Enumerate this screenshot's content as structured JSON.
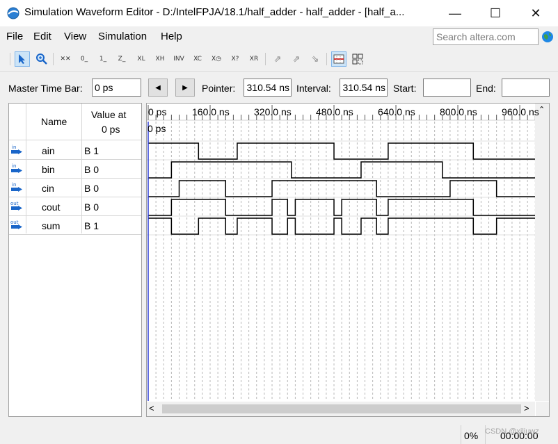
{
  "window": {
    "title": "Simulation Waveform Editor - D:/IntelFPJA/18.1/half_adder - half_adder - [half_a...",
    "minimize": "—",
    "maximize": "☐",
    "close": "✕"
  },
  "menu": {
    "file": "File",
    "edit": "Edit",
    "view": "View",
    "simulation": "Simulation",
    "help": "Help",
    "search_placeholder": "Search altera.com"
  },
  "toolbar": {
    "icons": [
      "pointer-icon",
      "zoom-icon",
      "unknown-value-icon",
      "forcing-low-icon",
      "forcing-high-icon",
      "high-impedance-icon",
      "weak-low-icon",
      "weak-high-icon",
      "invert-icon",
      "count-value-icon",
      "clock-icon",
      "arbitrary-value-icon",
      "random-value-icon",
      "run-functional-icon",
      "run-timing-icon",
      "timing-netlist-icon",
      "snap-to-grid-icon",
      "grid-settings-icon"
    ],
    "glyphs": [
      "⬉",
      "🔍",
      "X̲",
      "0̲",
      "1̲",
      "Z̲",
      "X̲L",
      "X̲H",
      "INV",
      "X̲C",
      "X̲○",
      "X̲?",
      "X̲R",
      "⇗",
      "⇗",
      "⇘",
      "▦",
      "▩"
    ]
  },
  "timebar": {
    "master_label": "Master Time Bar:",
    "master_value": "0 ps",
    "prev_glyph": "◀",
    "next_glyph": "▶",
    "pointer_label": "Pointer:",
    "pointer_value": "310.54 ns",
    "interval_label": "Interval:",
    "interval_value": "310.54 ns",
    "start_label": "Start:",
    "start_value": "",
    "end_label": "End:",
    "end_value": ""
  },
  "signals_header": {
    "name": "Name",
    "value_line1": "Value at",
    "value_line2": "0 ps"
  },
  "signals": [
    {
      "dir": "in",
      "name": "ain",
      "value": "B 1"
    },
    {
      "dir": "in",
      "name": "bin",
      "value": "B 0"
    },
    {
      "dir": "in",
      "name": "cin",
      "value": "B 0"
    },
    {
      "dir": "out",
      "name": "cout",
      "value": "B 0"
    },
    {
      "dir": "out",
      "name": "sum",
      "value": "B 1"
    }
  ],
  "timeline": {
    "ticks": [
      "0 ps",
      "160.0 ns",
      "320.0 ns",
      "480.0 ns",
      "640.0 ns",
      "800.0 ns",
      "960.0 ns"
    ],
    "cursor_label": "0 ps",
    "unit_ns_per_tick": 160
  },
  "waveforms": {
    "ain": [
      [
        0,
        1
      ],
      [
        130,
        0
      ],
      [
        230,
        1
      ],
      [
        480,
        0
      ],
      [
        620,
        1
      ],
      [
        840,
        0
      ],
      [
        1000,
        0
      ]
    ],
    "bin": [
      [
        0,
        0
      ],
      [
        60,
        1
      ],
      [
        370,
        0
      ],
      [
        550,
        1
      ],
      [
        760,
        0
      ],
      [
        1000,
        0
      ]
    ],
    "cin": [
      [
        0,
        0
      ],
      [
        80,
        1
      ],
      [
        200,
        0
      ],
      [
        320,
        1
      ],
      [
        590,
        0
      ],
      [
        780,
        1
      ],
      [
        900,
        0
      ],
      [
        1000,
        0
      ]
    ],
    "cout": [
      [
        0,
        0
      ],
      [
        60,
        1
      ],
      [
        200,
        0
      ],
      [
        320,
        1
      ],
      [
        360,
        0
      ],
      [
        380,
        1
      ],
      [
        480,
        0
      ],
      [
        500,
        1
      ],
      [
        590,
        0
      ],
      [
        620,
        1
      ],
      [
        840,
        0
      ],
      [
        1000,
        0
      ]
    ],
    "sum": [
      [
        0,
        1
      ],
      [
        60,
        0
      ],
      [
        130,
        1
      ],
      [
        200,
        0
      ],
      [
        230,
        1
      ],
      [
        320,
        0
      ],
      [
        360,
        1
      ],
      [
        380,
        0
      ],
      [
        480,
        1
      ],
      [
        500,
        0
      ],
      [
        550,
        1
      ],
      [
        590,
        0
      ],
      [
        620,
        1
      ],
      [
        840,
        0
      ],
      [
        900,
        1
      ],
      [
        1000,
        1
      ]
    ]
  },
  "statusbar": {
    "progress": "0%",
    "time": "00:00:00",
    "watermark": "CSDN @xiliuwz"
  }
}
